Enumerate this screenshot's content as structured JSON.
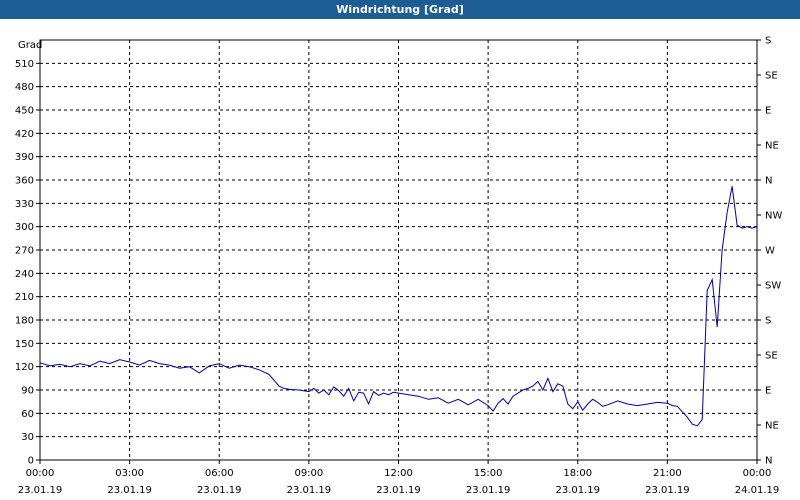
{
  "window": {
    "title": "Windrichtung [Grad]"
  },
  "chart_data": {
    "type": "line",
    "title": "Windrichtung [Grad]",
    "ylabel": "Grad",
    "ylim": [
      0,
      540
    ],
    "grid": true,
    "y_ticks": [
      0,
      30,
      60,
      90,
      120,
      150,
      180,
      210,
      240,
      270,
      300,
      330,
      360,
      390,
      420,
      450,
      480,
      510
    ],
    "y2_ticks": [
      {
        "value": 0,
        "label": "N"
      },
      {
        "value": 45,
        "label": "NE"
      },
      {
        "value": 90,
        "label": "E"
      },
      {
        "value": 135,
        "label": "SE"
      },
      {
        "value": 180,
        "label": "S"
      },
      {
        "value": 225,
        "label": "SW"
      },
      {
        "value": 270,
        "label": "W"
      },
      {
        "value": 315,
        "label": "NW"
      },
      {
        "value": 360,
        "label": "N"
      },
      {
        "value": 405,
        "label": "NE"
      },
      {
        "value": 450,
        "label": "E"
      },
      {
        "value": 495,
        "label": "SE"
      },
      {
        "value": 540,
        "label": "S"
      }
    ],
    "x_range": [
      "2019-01-23 00:00",
      "2019-01-24 00:00"
    ],
    "x_ticks": [
      {
        "time": "00:00",
        "date": "23.01.19"
      },
      {
        "time": "03:00",
        "date": "23.01.19"
      },
      {
        "time": "06:00",
        "date": "23.01.19"
      },
      {
        "time": "09:00",
        "date": "23.01.19"
      },
      {
        "time": "12:00",
        "date": "23.01.19"
      },
      {
        "time": "15:00",
        "date": "23.01.19"
      },
      {
        "time": "18:00",
        "date": "23.01.19"
      },
      {
        "time": "21:00",
        "date": "23.01.19"
      },
      {
        "time": "00:00",
        "date": "24.01.19"
      }
    ],
    "series": [
      {
        "color": "#0000a0",
        "x": [
          "00:00",
          "00:20",
          "00:40",
          "01:00",
          "01:20",
          "01:40",
          "02:00",
          "02:20",
          "02:40",
          "03:00",
          "03:20",
          "03:40",
          "04:00",
          "04:20",
          "04:40",
          "05:00",
          "05:20",
          "05:40",
          "06:00",
          "06:20",
          "06:40",
          "07:00",
          "07:20",
          "07:40",
          "08:00",
          "08:10",
          "08:20",
          "08:40",
          "09:00",
          "09:10",
          "09:20",
          "09:30",
          "09:40",
          "09:50",
          "10:00",
          "10:10",
          "10:20",
          "10:30",
          "10:40",
          "10:50",
          "11:00",
          "11:10",
          "11:20",
          "11:30",
          "11:40",
          "11:50",
          "12:00",
          "12:20",
          "12:40",
          "13:00",
          "13:20",
          "13:40",
          "14:00",
          "14:20",
          "14:40",
          "15:00",
          "15:10",
          "15:20",
          "15:30",
          "15:40",
          "15:50",
          "16:00",
          "16:10",
          "16:20",
          "16:30",
          "16:40",
          "16:50",
          "17:00",
          "17:10",
          "17:20",
          "17:30",
          "17:40",
          "17:50",
          "18:00",
          "18:10",
          "18:20",
          "18:30",
          "18:40",
          "18:50",
          "19:00",
          "19:20",
          "19:40",
          "20:00",
          "20:20",
          "20:40",
          "21:00",
          "21:10",
          "21:20",
          "21:30",
          "21:40",
          "21:50",
          "22:00",
          "22:10",
          "22:20",
          "22:30",
          "22:40",
          "22:50",
          "23:00",
          "23:10",
          "23:20",
          "23:30",
          "23:40",
          "23:50",
          "24:00"
        ],
        "y": [
          125,
          121,
          123,
          120,
          124,
          121,
          127,
          124,
          129,
          126,
          122,
          128,
          124,
          122,
          118,
          120,
          112,
          121,
          124,
          118,
          122,
          120,
          116,
          110,
          95,
          92,
          91,
          90,
          88,
          92,
          86,
          90,
          84,
          94,
          89,
          82,
          92,
          76,
          87,
          86,
          72,
          88,
          83,
          86,
          84,
          87,
          86,
          84,
          82,
          78,
          80,
          73,
          78,
          71,
          78,
          70,
          63,
          73,
          79,
          72,
          82,
          86,
          90,
          92,
          95,
          101,
          90,
          105,
          88,
          98,
          95,
          72,
          66,
          75,
          64,
          72,
          78,
          74,
          69,
          71,
          76,
          72,
          70,
          72,
          74,
          73,
          70,
          69,
          62,
          55,
          46,
          44,
          52,
          218,
          232,
          171,
          270,
          318,
          352,
          302,
          298,
          300,
          298,
          300
        ]
      }
    ]
  }
}
